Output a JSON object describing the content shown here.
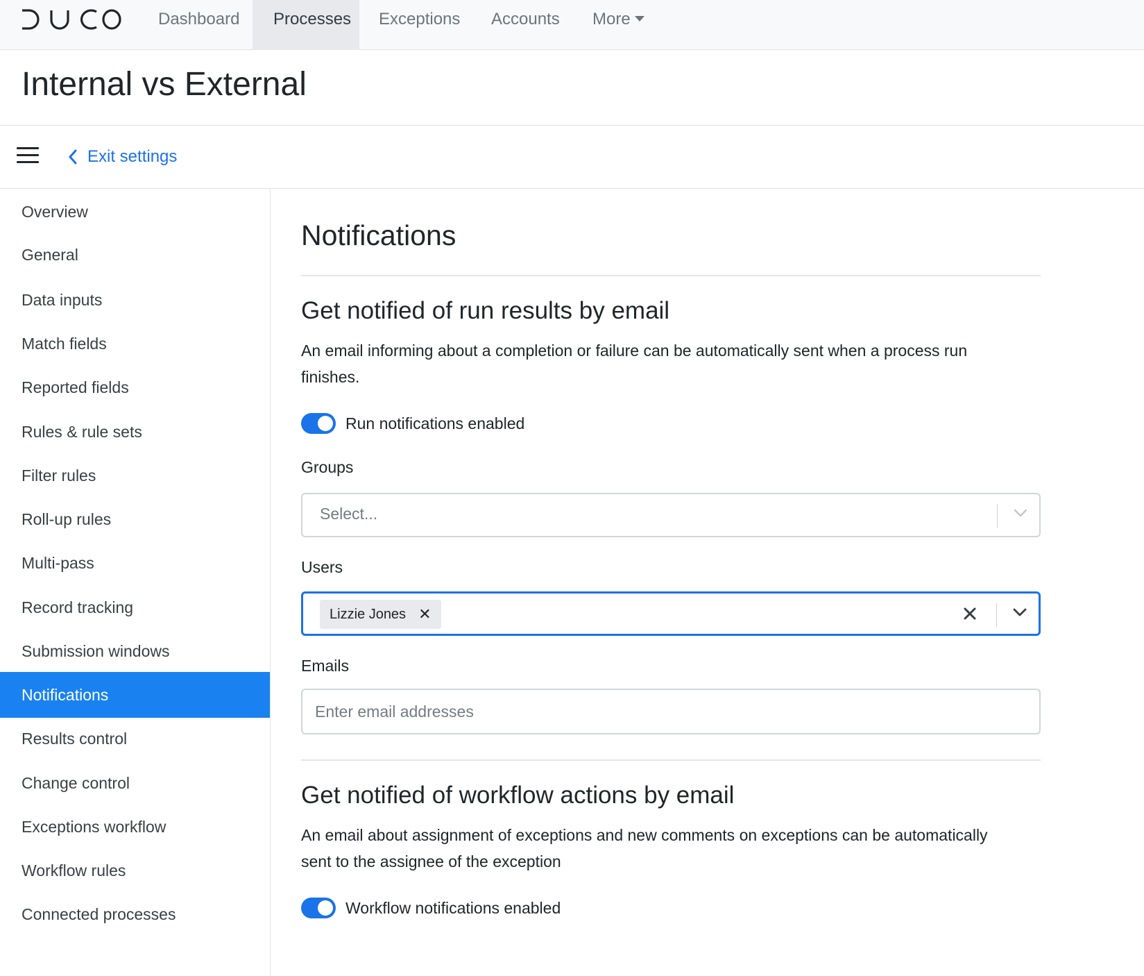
{
  "app": {
    "logo_text": "DUCO"
  },
  "nav": {
    "items": [
      {
        "label": "Dashboard"
      },
      {
        "label": "Processes"
      },
      {
        "label": "Exceptions"
      },
      {
        "label": "Accounts"
      },
      {
        "label": "More"
      }
    ]
  },
  "page": {
    "title": "Internal vs External"
  },
  "settings_bar": {
    "exit_label": "Exit settings"
  },
  "sidebar": {
    "items": [
      {
        "label": "Overview"
      },
      {
        "label": "General"
      },
      {
        "label": "Data inputs"
      },
      {
        "label": "Match fields"
      },
      {
        "label": "Reported fields"
      },
      {
        "label": "Rules & rule sets"
      },
      {
        "label": "Filter rules"
      },
      {
        "label": "Roll-up rules"
      },
      {
        "label": "Multi-pass"
      },
      {
        "label": "Record tracking"
      },
      {
        "label": "Submission windows"
      },
      {
        "label": "Notifications"
      },
      {
        "label": "Results control"
      },
      {
        "label": "Change control"
      },
      {
        "label": "Exceptions workflow"
      },
      {
        "label": "Workflow rules"
      },
      {
        "label": "Connected processes"
      }
    ],
    "active": "Notifications"
  },
  "main": {
    "title": "Notifications",
    "run_section": {
      "heading": "Get notified of run results by email",
      "description": "An email informing about a completion or failure can be automatically sent when a process run finishes.",
      "toggle_label": "Run notifications enabled",
      "toggle_on": true,
      "groups_label": "Groups",
      "groups_placeholder": "Select...",
      "users_label": "Users",
      "users_selected": [
        "Lizzie Jones"
      ],
      "emails_label": "Emails",
      "emails_placeholder": "Enter email addresses"
    },
    "workflow_section": {
      "heading": "Get notified of workflow actions by email",
      "description": "An email about assignment of exceptions and new comments on exceptions can be automatically sent to the assignee of the exception",
      "toggle_label": "Workflow notifications enabled",
      "toggle_on": true
    }
  },
  "colors": {
    "accent": "#1a73e8",
    "active_sidebar": "#1a82f0"
  }
}
